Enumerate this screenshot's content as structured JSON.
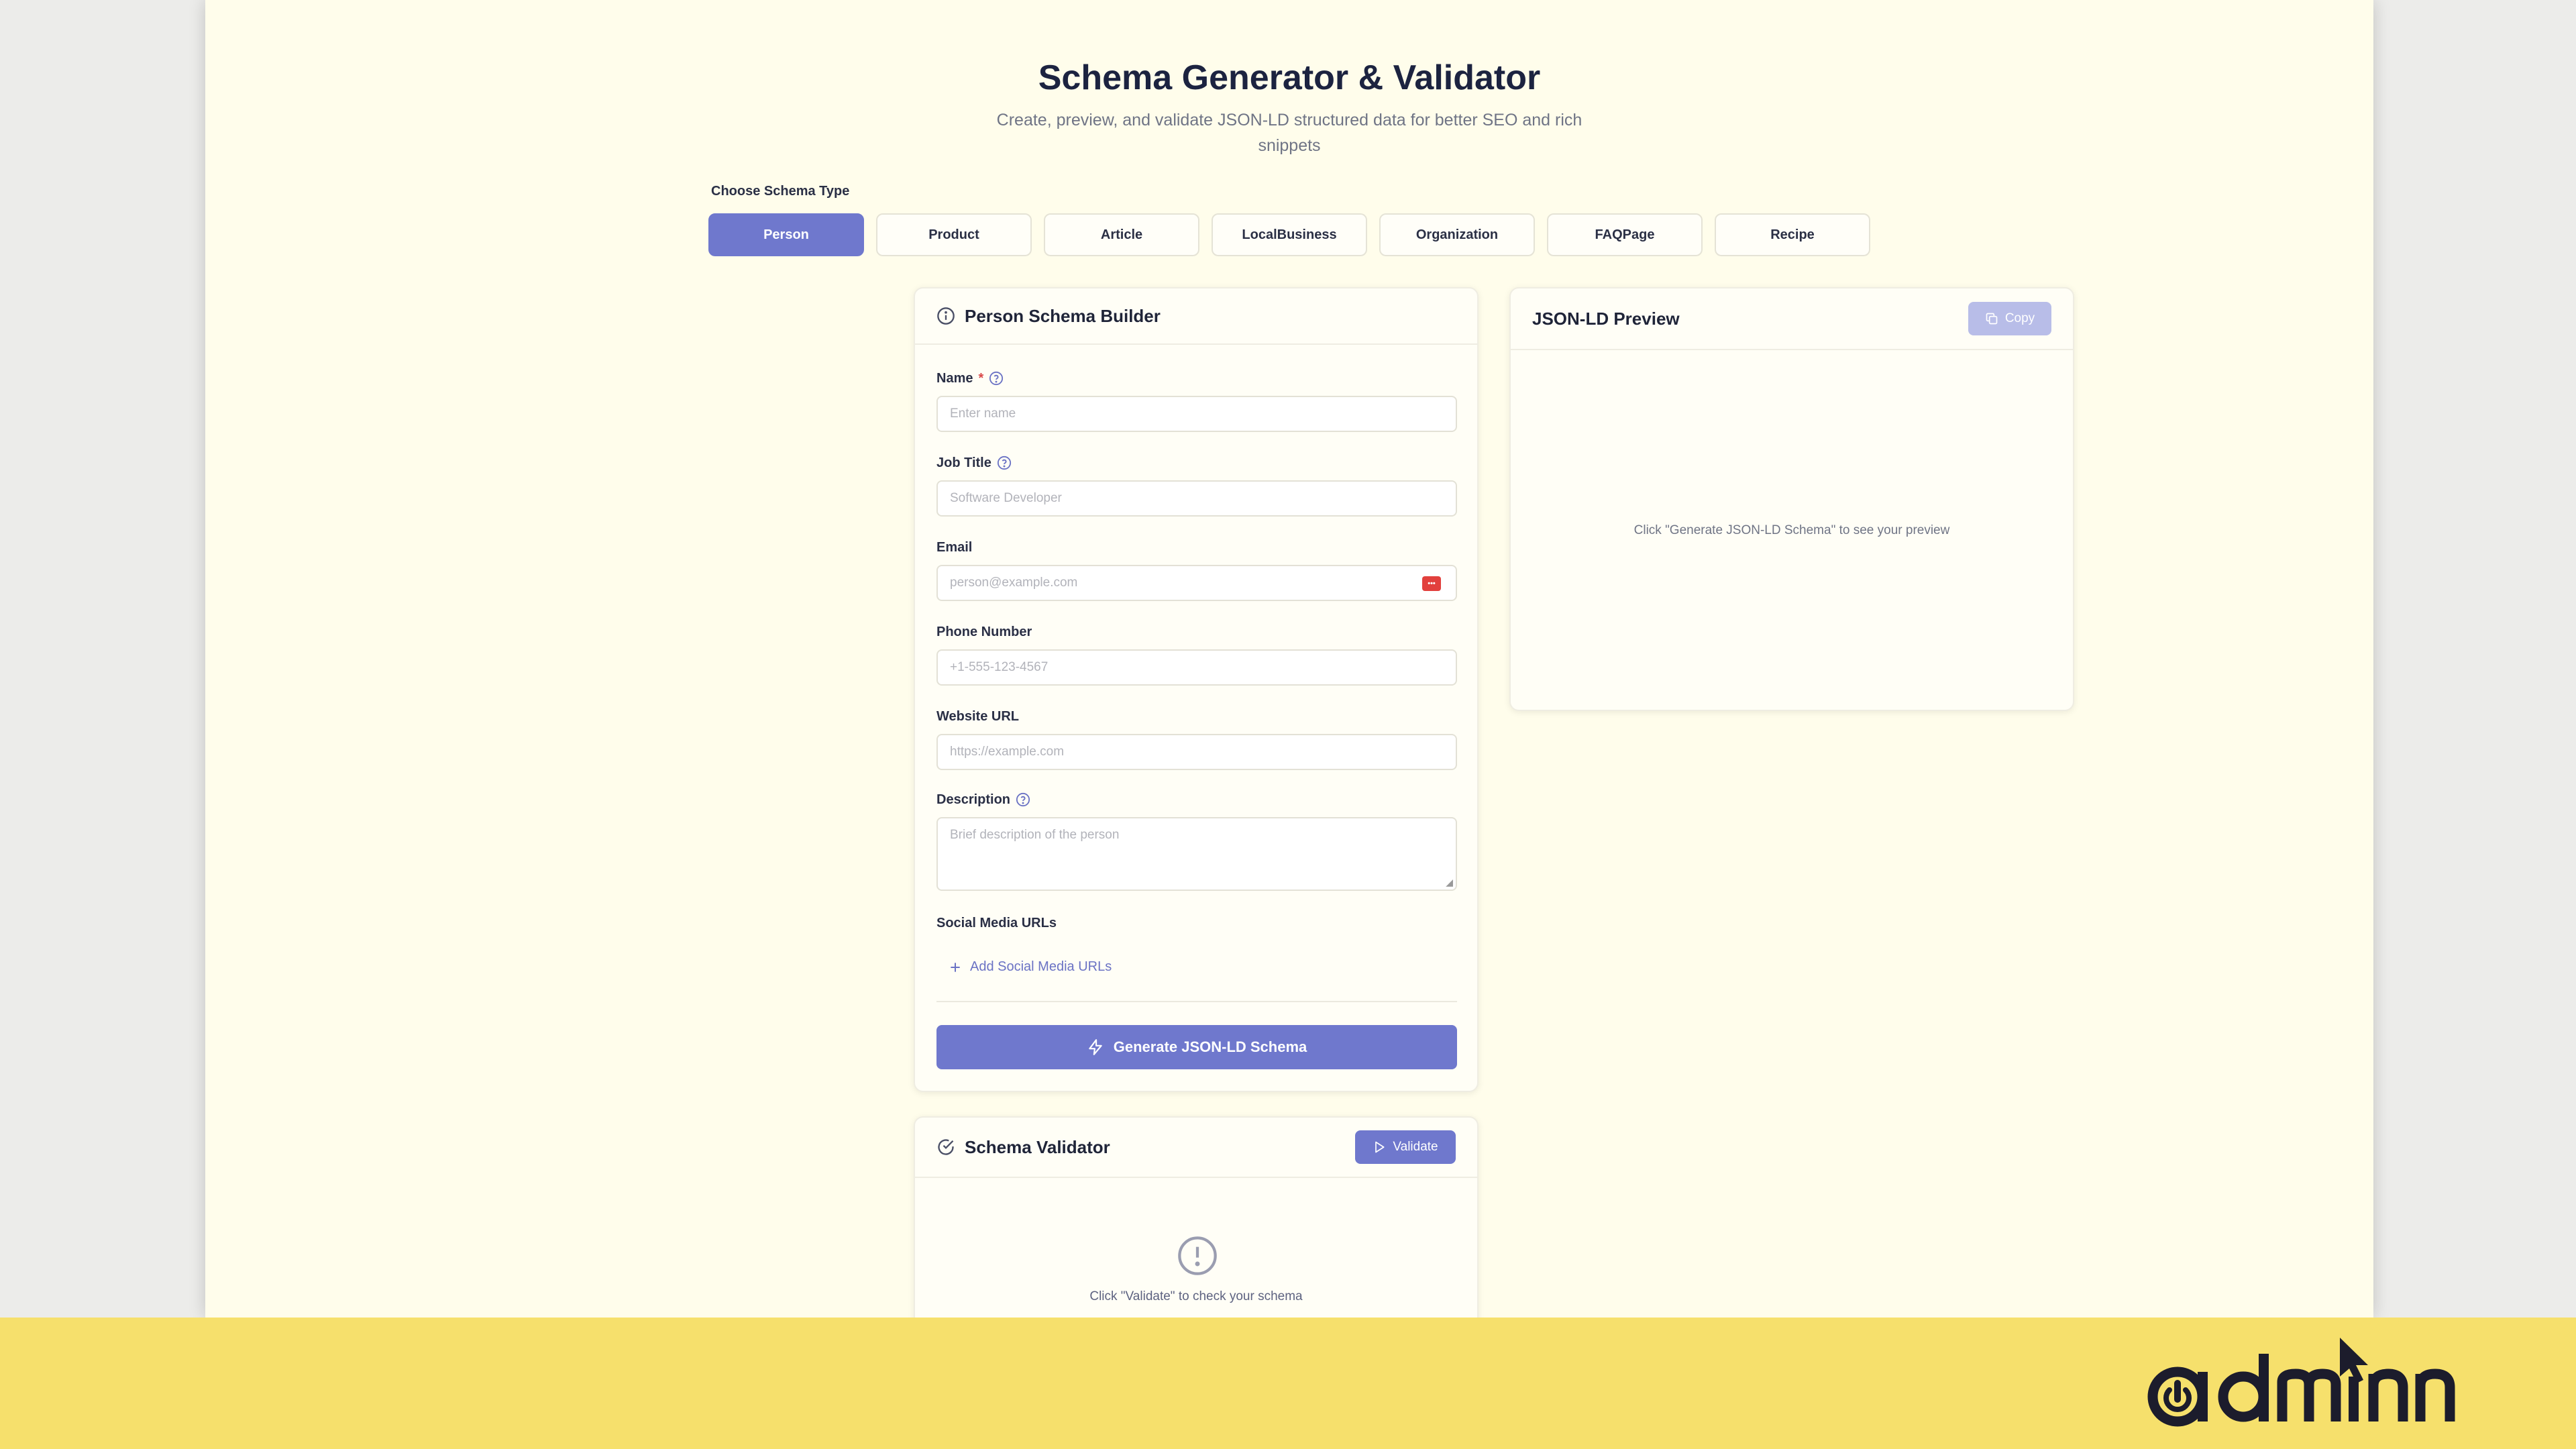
{
  "header": {
    "title": "Schema Generator & Validator",
    "subtitle": "Create, preview, and validate JSON-LD structured data for better SEO and rich snippets"
  },
  "schema_type": {
    "label": "Choose Schema Type",
    "options": [
      "Person",
      "Product",
      "Article",
      "LocalBusiness",
      "Organization",
      "FAQPage",
      "Recipe"
    ],
    "selected": "Person"
  },
  "builder": {
    "title": "Person Schema Builder",
    "fields": {
      "name": {
        "label": "Name",
        "required_mark": "*",
        "placeholder": "Enter name"
      },
      "job_title": {
        "label": "Job Title",
        "placeholder": "Software Developer"
      },
      "email": {
        "label": "Email",
        "placeholder": "person@example.com"
      },
      "phone": {
        "label": "Phone Number",
        "placeholder": "+1-555-123-4567"
      },
      "website": {
        "label": "Website URL",
        "placeholder": "https://example.com"
      },
      "description": {
        "label": "Description",
        "placeholder": "Brief description of the person"
      }
    },
    "social": {
      "label": "Social Media URLs",
      "add_label": "Add Social Media URLs"
    },
    "generate_label": "Generate JSON-LD Schema"
  },
  "preview": {
    "title": "JSON-LD Preview",
    "copy_label": "Copy",
    "hint": "Click \"Generate JSON-LD Schema\" to see your preview"
  },
  "validator": {
    "title": "Schema Validator",
    "validate_label": "Validate",
    "hint": "Click \"Validate\" to check your schema"
  },
  "colors": {
    "accent": "#6f78cd",
    "page_background": "#fffdeb",
    "footer_band": "#f6e06c",
    "logo": "#1c1c2c"
  },
  "icons": {
    "builder": "info-circle-icon",
    "help": "question-circle-icon",
    "add": "plus-icon",
    "generate": "lightning-icon",
    "copy": "copy-icon",
    "validator": "check-circle-icon",
    "validate": "play-icon",
    "status": "exclamation-circle-icon"
  },
  "branding": {
    "logo_text": "admınn"
  }
}
